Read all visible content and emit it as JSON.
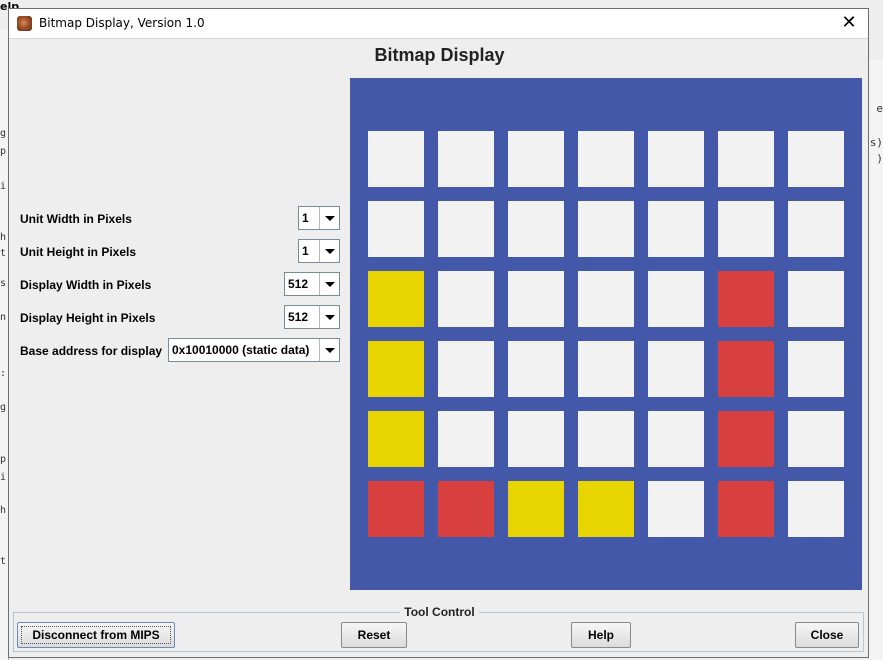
{
  "background": {
    "menu_fragment": "elp",
    "left_glyphs": [
      "g",
      "p",
      "i",
      "h",
      "t",
      "s",
      "n",
      ":",
      "g",
      "p",
      "i",
      "h",
      "t"
    ],
    "right_glyphs": [
      "e",
      "s)",
      ")"
    ]
  },
  "window": {
    "title": "Bitmap Display, Version 1.0",
    "icon": "mars-app-icon",
    "close_symbol": "✕"
  },
  "heading": "Bitmap Display",
  "settings": [
    {
      "label": "Unit Width in Pixels",
      "value": "1"
    },
    {
      "label": "Unit Height in Pixels",
      "value": "1"
    },
    {
      "label": "Display Width in Pixels",
      "value": "512"
    },
    {
      "label": "Display Height in Pixels",
      "value": "512"
    },
    {
      "label": "Base address for display",
      "value": "0x10010000 (static data)"
    }
  ],
  "colors": {
    "background": "#4358a8",
    "white": "#f2f2f2",
    "yellow": "#e8d400",
    "red": "#d84040"
  },
  "bitmap": {
    "grid": [
      [
        "W",
        "W",
        "W",
        "W",
        "W",
        "W",
        "W"
      ],
      [
        "W",
        "W",
        "W",
        "W",
        "W",
        "W",
        "W"
      ],
      [
        "Y",
        "W",
        "W",
        "W",
        "W",
        "R",
        "W"
      ],
      [
        "Y",
        "W",
        "W",
        "W",
        "W",
        "R",
        "W"
      ],
      [
        "Y",
        "W",
        "W",
        "W",
        "W",
        "R",
        "W"
      ],
      [
        "R",
        "R",
        "Y",
        "Y",
        "W",
        "R",
        "W"
      ]
    ]
  },
  "tool_control": {
    "legend": "Tool Control",
    "buttons": {
      "connect": "Disconnect from MIPS",
      "reset": "Reset",
      "help": "Help",
      "close": "Close"
    }
  }
}
